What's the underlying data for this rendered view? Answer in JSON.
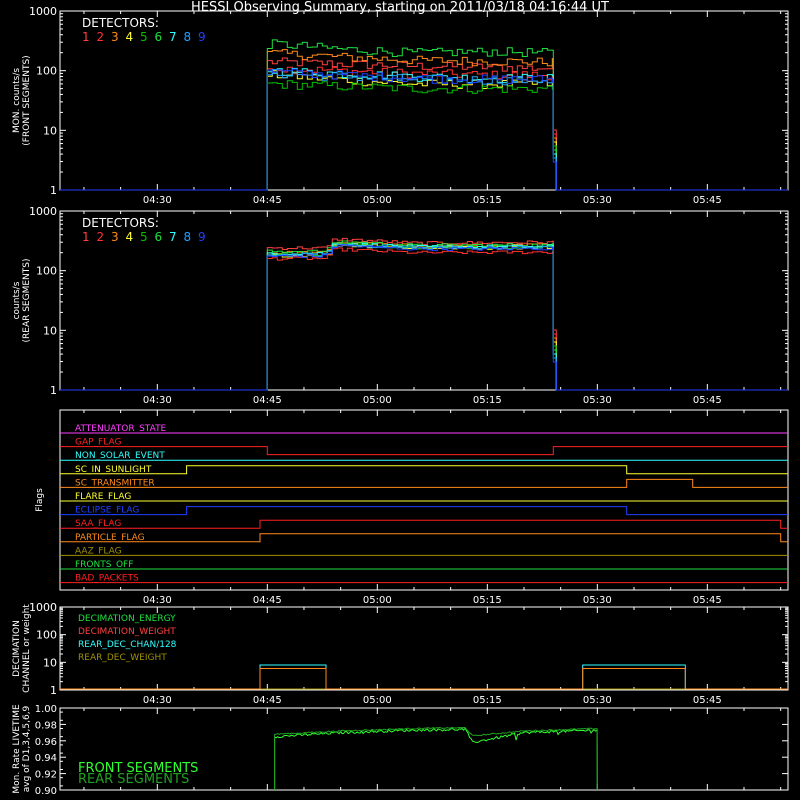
{
  "title": "HESSI Observing Summary, starting on 2011/03/18 04:16:44 UT",
  "detector_colors": [
    "#ff4040",
    "#ff3030",
    "#ff8a1a",
    "#ffff30",
    "#00c000",
    "#20e040",
    "#30ffff",
    "#20a0ff",
    "#2040ff"
  ],
  "chart_data": [
    {
      "id": "front",
      "type": "line",
      "ylabel": "MON. counts/s",
      "ylabel2": "(FRONT SEGMENTS)",
      "yscale": "log",
      "ylim": [
        1,
        1000
      ],
      "yticks": [
        "1",
        "10",
        "100",
        "1000"
      ],
      "xlim": [
        "04:16:44",
        "05:56:00"
      ],
      "xticks": [
        "04:30",
        "04:45",
        "05:00",
        "05:15",
        "05:30",
        "05:45"
      ],
      "legend_title": "DETECTORS:",
      "legend_items": [
        "1",
        "2",
        "3",
        "4",
        "5",
        "6",
        "7",
        "8",
        "9"
      ],
      "legend_position": "top-left",
      "series": [
        {
          "label": "1",
          "color": "#ff4040",
          "x": [
            "04:45",
            "04:46",
            "04:55",
            "05:05",
            "05:15",
            "05:24"
          ],
          "values": [
            140,
            140,
            130,
            120,
            115,
            110
          ]
        },
        {
          "label": "2",
          "color": "#ff3030",
          "x": [
            "04:45",
            "04:46",
            "04:55",
            "05:05",
            "05:15",
            "05:24"
          ],
          "values": [
            110,
            110,
            100,
            90,
            85,
            85
          ]
        },
        {
          "label": "3",
          "color": "#ff8a1a",
          "x": [
            "04:45",
            "04:46",
            "04:55",
            "05:05",
            "05:15",
            "05:24"
          ],
          "values": [
            195,
            195,
            170,
            150,
            145,
            140
          ]
        },
        {
          "label": "4",
          "color": "#ffff30",
          "x": [
            "04:45",
            "04:46",
            "04:55",
            "05:05",
            "05:15",
            "05:24"
          ],
          "values": [
            85,
            85,
            70,
            60,
            60,
            60
          ]
        },
        {
          "label": "5",
          "color": "#00c000",
          "x": [
            "04:45",
            "04:46",
            "04:55",
            "05:05",
            "05:15",
            "05:24"
          ],
          "values": [
            60,
            60,
            55,
            50,
            50,
            50
          ]
        },
        {
          "label": "6",
          "color": "#20e040",
          "x": [
            "04:45",
            "04:46",
            "04:55",
            "05:05",
            "05:15",
            "05:24"
          ],
          "values": [
            280,
            280,
            230,
            200,
            210,
            200
          ]
        },
        {
          "label": "7",
          "color": "#30ffff",
          "x": [
            "04:45",
            "04:46",
            "04:55",
            "05:05",
            "05:15",
            "05:24"
          ],
          "values": [
            100,
            100,
            90,
            80,
            75,
            75
          ]
        },
        {
          "label": "8",
          "color": "#20a0ff",
          "x": [
            "04:45",
            "04:46",
            "04:55",
            "05:05",
            "05:15",
            "05:24"
          ],
          "values": [
            90,
            90,
            80,
            72,
            70,
            70
          ]
        },
        {
          "label": "9",
          "color": "#2040ff",
          "x": [
            "04:45",
            "04:46",
            "04:55",
            "05:05",
            "05:15",
            "05:24"
          ],
          "values": [
            95,
            95,
            85,
            75,
            72,
            72
          ]
        }
      ]
    },
    {
      "id": "rear",
      "type": "line",
      "ylabel": "counts/s",
      "ylabel2": "(REAR SEGMENTS)",
      "yscale": "log",
      "ylim": [
        1,
        1000
      ],
      "yticks": [
        "1",
        "10",
        "100",
        "1000"
      ],
      "xlim": [
        "04:16:44",
        "05:56:00"
      ],
      "xticks": [
        "04:30",
        "04:45",
        "05:00",
        "05:15",
        "05:30",
        "05:45"
      ],
      "legend_title": "DETECTORS:",
      "legend_items": [
        "1",
        "2",
        "3",
        "4",
        "5",
        "6",
        "7",
        "8",
        "9"
      ],
      "legend_position": "top-left",
      "series": [
        {
          "label": "1",
          "color": "#ff4040",
          "x": [
            "04:45",
            "04:53",
            "04:54",
            "05:05",
            "05:24"
          ],
          "values": [
            240,
            240,
            340,
            290,
            300
          ]
        },
        {
          "label": "2",
          "color": "#ff3030",
          "x": [
            "04:45",
            "04:53",
            "04:54",
            "05:05",
            "05:24"
          ],
          "values": [
            160,
            160,
            230,
            200,
            205
          ]
        },
        {
          "label": "3",
          "color": "#ff8a1a",
          "x": [
            "04:45",
            "04:53",
            "04:54",
            "05:05",
            "05:24"
          ],
          "values": [
            200,
            200,
            300,
            260,
            270
          ]
        },
        {
          "label": "4",
          "color": "#ffff30",
          "x": [
            "04:45",
            "04:53",
            "04:54",
            "05:05",
            "05:24"
          ],
          "values": [
            180,
            180,
            270,
            240,
            245
          ]
        },
        {
          "label": "5",
          "color": "#00c000",
          "x": [
            "04:45",
            "04:53",
            "04:54",
            "05:05",
            "05:24"
          ],
          "values": [
            190,
            190,
            280,
            245,
            250
          ]
        },
        {
          "label": "6",
          "color": "#20e040",
          "x": [
            "04:45",
            "04:53",
            "04:54",
            "05:05",
            "05:24"
          ],
          "values": [
            210,
            210,
            310,
            265,
            270
          ]
        },
        {
          "label": "7",
          "color": "#30ffff",
          "x": [
            "04:45",
            "04:53",
            "04:54",
            "05:05",
            "05:24"
          ],
          "values": [
            195,
            195,
            290,
            250,
            255
          ]
        },
        {
          "label": "8",
          "color": "#20a0ff",
          "x": [
            "04:45",
            "04:53",
            "04:54",
            "05:05",
            "05:24"
          ],
          "values": [
            185,
            185,
            275,
            240,
            245
          ]
        },
        {
          "label": "9",
          "color": "#2040ff",
          "x": [
            "04:45",
            "04:53",
            "04:54",
            "05:05",
            "05:24"
          ],
          "values": [
            175,
            175,
            265,
            230,
            235
          ]
        }
      ]
    },
    {
      "id": "flags",
      "type": "line",
      "ylabel": "Flags",
      "xlim": [
        "04:16:44",
        "05:56:00"
      ],
      "xticks": [
        "04:30",
        "04:45",
        "05:00",
        "05:15",
        "05:30",
        "05:45"
      ],
      "flags": [
        {
          "name": "ATTENUATOR_STATE",
          "color": "#ff40ff",
          "transitions": []
        },
        {
          "name": "GAP_FLAG",
          "color": "#ff2020",
          "transitions": [
            [
              "04:45",
              "05:24"
            ]
          ]
        },
        {
          "name": "NON_SOLAR_EVENT",
          "color": "#30ffff",
          "transitions": []
        },
        {
          "name": "SC_IN_SUNLIGHT",
          "color": "#ffff30",
          "transitions": [
            [
              "04:34",
              "05:34"
            ]
          ]
        },
        {
          "name": "SC_TRANSMITTER",
          "color": "#ff8a1a",
          "transitions": [
            [
              "05:34",
              "05:43"
            ]
          ]
        },
        {
          "name": "FLARE_FLAG",
          "color": "#ffff30",
          "transitions": []
        },
        {
          "name": "ECLIPSE_FLAG",
          "color": "#2040ff",
          "transitions": [
            [
              "04:34",
              "05:34"
            ]
          ]
        },
        {
          "name": "SAA_FLAG",
          "color": "#ff2020",
          "transitions": [
            [
              "04:44",
              "05:55"
            ]
          ]
        },
        {
          "name": "PARTICLE_FLAG",
          "color": "#ff8a1a",
          "transitions": [
            [
              "04:44",
              "05:55"
            ]
          ]
        },
        {
          "name": "AAZ_FLAG",
          "color": "#a09000",
          "transitions": []
        },
        {
          "name": "FRONTS_OFF",
          "color": "#20e040",
          "transitions": []
        },
        {
          "name": "BAD_PACKETS",
          "color": "#ff2020",
          "transitions": []
        }
      ]
    },
    {
      "id": "decimation",
      "type": "line",
      "ylabel": "DECIMATION",
      "ylabel2": "CHANNEL or weight",
      "yscale": "log",
      "ylim": [
        1,
        1000
      ],
      "yticks": [
        "1",
        "10",
        "100",
        "1000"
      ],
      "xlim": [
        "04:16:44",
        "05:56:00"
      ],
      "xticks": [
        "04:30",
        "04:45",
        "05:00",
        "05:15",
        "05:30",
        "05:45"
      ],
      "legend_items": [
        {
          "name": "DECIMATION_ENERGY",
          "color": "#20e040"
        },
        {
          "name": "DECIMATION_WEIGHT",
          "color": "#ff4040"
        },
        {
          "name": "REAR_DEC_CHAN/128",
          "color": "#30ffff"
        },
        {
          "name": "REAR_DEC_WEIGHT",
          "color": "#a09000"
        }
      ],
      "series": [
        {
          "name": "REAR_DEC_CHAN/128",
          "color": "#30ffff",
          "segments": [
            [
              "04:44",
              "04:53",
              8
            ],
            [
              "05:28",
              "05:42",
              8
            ]
          ]
        },
        {
          "name": "REAR_DEC_WEIGHT",
          "color": "#ff8a1a",
          "segments": [
            [
              "04:44",
              "04:53",
              6
            ],
            [
              "05:28",
              "05:42",
              6
            ]
          ]
        }
      ]
    },
    {
      "id": "livetime",
      "type": "line",
      "ylabel": "Mon. Rate LIVETIME",
      "ylabel2": "avg of D1,3,4,5,6,9",
      "ylim": [
        0.9,
        1.0
      ],
      "yticks": [
        "0.90",
        "0.92",
        "0.94",
        "0.96",
        "0.98",
        "1.00"
      ],
      "xlim": [
        "04:16:44",
        "05:56:00"
      ],
      "legend_items": [
        {
          "name": "FRONT SEGMENTS",
          "color": "#30ff30"
        },
        {
          "name": "REAR SEGMENTS",
          "color": "#20a020"
        }
      ],
      "series": [
        {
          "name": "FRONT SEGMENTS",
          "color": "#30ff30",
          "x": [
            "04:46",
            "04:55",
            "05:05",
            "05:12",
            "05:13",
            "05:20",
            "05:30"
          ],
          "values": [
            0.965,
            0.97,
            0.973,
            0.974,
            0.958,
            0.97,
            0.973
          ]
        },
        {
          "name": "REAR SEGMENTS",
          "color": "#20a020",
          "x": [
            "04:46",
            "04:55",
            "05:05",
            "05:12",
            "05:13",
            "05:20",
            "05:30"
          ],
          "values": [
            0.968,
            0.972,
            0.975,
            0.976,
            0.966,
            0.972,
            0.975
          ]
        }
      ]
    }
  ]
}
